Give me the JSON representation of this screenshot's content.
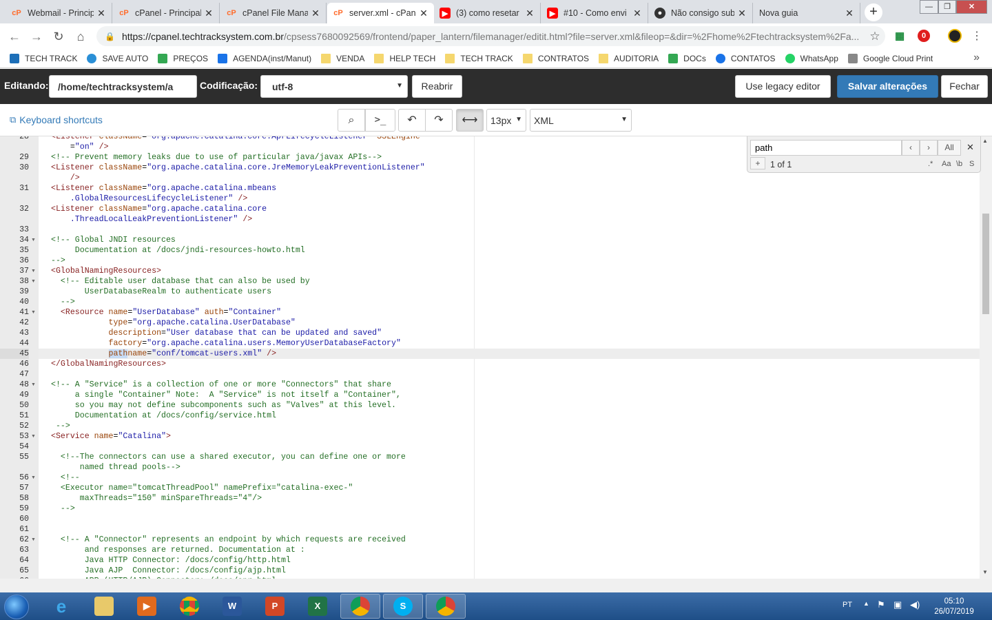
{
  "browser": {
    "tabs": [
      {
        "icon": "cpanel-icon",
        "title": "Webmail - Princip",
        "active": false
      },
      {
        "icon": "cpanel-icon",
        "title": "cPanel - Principal",
        "active": false
      },
      {
        "icon": "cpanel-icon",
        "title": "cPanel File Mana",
        "active": false
      },
      {
        "icon": "cpanel-icon",
        "title": "server.xml - cPan",
        "active": true
      },
      {
        "icon": "youtube-icon",
        "title": "(3) como resetar",
        "active": false
      },
      {
        "icon": "youtube-icon",
        "title": "#10 - Como envi",
        "active": false
      },
      {
        "icon": "github-icon",
        "title": "Não consigo sub",
        "active": false
      },
      {
        "icon": "",
        "title": "Nova guia",
        "active": false
      }
    ],
    "url_host": "https://cpanel.techtracksystem.com.br",
    "url_path": "/cpsess7680092569/frontend/paper_lantern/filemanager/editit.html?file=server.xml&fileop=&dir=%2Fhome%2Ftechtracksystem%2Fa...",
    "bookmarks": [
      {
        "label": "TECH TRACK",
        "icon": "techtrack-icon"
      },
      {
        "label": "SAVE AUTO",
        "icon": "saveauto-icon"
      },
      {
        "label": "PREÇOS",
        "icon": "drive-icon"
      },
      {
        "label": "AGENDA(inst/Manut)",
        "icon": "calendar-icon"
      },
      {
        "label": "VENDA",
        "icon": "folder-icon"
      },
      {
        "label": "HELP TECH",
        "icon": "folder-icon"
      },
      {
        "label": "TECH TRACK",
        "icon": "folder-icon"
      },
      {
        "label": "CONTRATOS",
        "icon": "folder-icon"
      },
      {
        "label": "AUDITORIA",
        "icon": "folder-icon"
      },
      {
        "label": "DOCs",
        "icon": "drive-icon"
      },
      {
        "label": "CONTATOS",
        "icon": "contacts-icon"
      },
      {
        "label": "WhatsApp",
        "icon": "whatsapp-icon"
      },
      {
        "label": "Google Cloud Print",
        "icon": "print-icon"
      }
    ],
    "bookmarks_more": "»"
  },
  "editor_header": {
    "editing_label": "Editando:",
    "path_value": "/home/techtracksystem/a",
    "encoding_label": "Codificação:",
    "encoding_value": "utf-8",
    "reopen": "Reabrir",
    "legacy": "Use legacy editor",
    "save": "Salvar alterações",
    "close": "Fechar"
  },
  "toolbar": {
    "shortcuts": "Keyboard shortcuts",
    "font_size": "13px",
    "mode": "XML"
  },
  "search": {
    "query": "path",
    "all": "All",
    "plus": "+",
    "count": "1 of 1",
    "regex": ".*",
    "case": "Aa",
    "word": "\\b",
    "sel": "S"
  },
  "code_lines": [
    {
      "n": "28",
      "f": false,
      "h": "<span class=\"t\">&lt;Listener</span> <span class=\"a\">className</span>=<span class=\"s\">\"org.apache.catalina.core.AprLifecycleListener\"</span> <span class=\"a\">SSLEngine</span>"
    },
    {
      "n": "",
      "f": false,
      "h": "    =<span class=\"s\">\"on\"</span> <span class=\"t\">/&gt;</span>"
    },
    {
      "n": "29",
      "f": false,
      "h": "<span class=\"c\">&lt;!-- Prevent memory leaks due to use of particular java/javax APIs--&gt;</span>"
    },
    {
      "n": "30",
      "f": false,
      "h": "<span class=\"t\">&lt;Listener</span> <span class=\"a\">className</span>=<span class=\"s\">\"org.apache.catalina.core.JreMemoryLeakPreventionListener\"</span>"
    },
    {
      "n": "",
      "f": false,
      "h": "    <span class=\"t\">/&gt;</span>"
    },
    {
      "n": "31",
      "f": false,
      "h": "<span class=\"t\">&lt;Listener</span> <span class=\"a\">className</span>=<span class=\"s\">\"org.apache.catalina.mbeans</span>"
    },
    {
      "n": "",
      "f": false,
      "h": "    <span class=\"s\">.GlobalResourcesLifecycleListener\"</span> <span class=\"t\">/&gt;</span>"
    },
    {
      "n": "32",
      "f": false,
      "h": "<span class=\"t\">&lt;Listener</span> <span class=\"a\">className</span>=<span class=\"s\">\"org.apache.catalina.core</span>"
    },
    {
      "n": "",
      "f": false,
      "h": "    <span class=\"s\">.ThreadLocalLeakPreventionListener\"</span> <span class=\"t\">/&gt;</span>"
    },
    {
      "n": "33",
      "f": false,
      "h": ""
    },
    {
      "n": "34",
      "f": true,
      "h": "<span class=\"c\">&lt;!-- Global JNDI resources</span>"
    },
    {
      "n": "35",
      "f": false,
      "h": "<span class=\"c\">     Documentation at /docs/jndi-resources-howto.html</span>"
    },
    {
      "n": "36",
      "f": false,
      "h": "<span class=\"c\">--&gt;</span>"
    },
    {
      "n": "37",
      "f": true,
      "h": "<span class=\"t\">&lt;GlobalNamingResources&gt;</span>"
    },
    {
      "n": "38",
      "f": true,
      "h": "  <span class=\"c\">&lt;!-- Editable user database that can also be used by</span>"
    },
    {
      "n": "39",
      "f": false,
      "h": "<span class=\"c\">       UserDatabaseRealm to authenticate users</span>"
    },
    {
      "n": "40",
      "f": false,
      "h": "<span class=\"c\">  --&gt;</span>"
    },
    {
      "n": "41",
      "f": true,
      "h": "  <span class=\"t\">&lt;Resource</span> <span class=\"a\">name</span>=<span class=\"s\">\"UserDatabase\"</span> <span class=\"a\">auth</span>=<span class=\"s\">\"Container\"</span>"
    },
    {
      "n": "42",
      "f": false,
      "h": "            <span class=\"a\">type</span>=<span class=\"s\">\"org.apache.catalina.UserDatabase\"</span>"
    },
    {
      "n": "43",
      "f": false,
      "h": "            <span class=\"a\">description</span>=<span class=\"s\">\"User database that can be updated and saved\"</span>"
    },
    {
      "n": "44",
      "f": false,
      "h": "            <span class=\"a\">factory</span>=<span class=\"s\">\"org.apache.catalina.users.MemoryUserDatabaseFactory\"</span>"
    },
    {
      "n": "45",
      "f": false,
      "h": "            <span class=\"a\"><span class=\"hl\">path</span>name</span>=<span class=\"s\">\"conf/tomcat-users.xml\"</span> <span class=\"t\">/&gt;</span>"
    },
    {
      "n": "46",
      "f": false,
      "h": "<span class=\"t\">&lt;/GlobalNamingResources&gt;</span>"
    },
    {
      "n": "47",
      "f": false,
      "h": ""
    },
    {
      "n": "48",
      "f": true,
      "h": "<span class=\"c\">&lt;!-- A \"Service\" is a collection of one or more \"Connectors\" that share</span>"
    },
    {
      "n": "49",
      "f": false,
      "h": "<span class=\"c\">     a single \"Container\" Note:  A \"Service\" is not itself a \"Container\",</span>"
    },
    {
      "n": "50",
      "f": false,
      "h": "<span class=\"c\">     so you may not define subcomponents such as \"Valves\" at this level.</span>"
    },
    {
      "n": "51",
      "f": false,
      "h": "<span class=\"c\">     Documentation at /docs/config/service.html</span>"
    },
    {
      "n": "52",
      "f": false,
      "h": "<span class=\"c\"> --&gt;</span>"
    },
    {
      "n": "53",
      "f": true,
      "h": "<span class=\"t\">&lt;Service</span> <span class=\"a\">name</span>=<span class=\"s\">\"Catalina\"</span><span class=\"t\">&gt;</span>"
    },
    {
      "n": "54",
      "f": false,
      "h": ""
    },
    {
      "n": "55",
      "f": false,
      "h": "  <span class=\"c\">&lt;!--The connectors can use a shared executor, you can define one or more</span>"
    },
    {
      "n": "",
      "f": false,
      "h": "<span class=\"c\">      named thread pools--&gt;</span>"
    },
    {
      "n": "56",
      "f": true,
      "h": "  <span class=\"c\">&lt;!--</span>"
    },
    {
      "n": "57",
      "f": false,
      "h": "<span class=\"c\">  &lt;Executor name=\"tomcatThreadPool\" namePrefix=\"catalina-exec-\"</span>"
    },
    {
      "n": "58",
      "f": false,
      "h": "<span class=\"c\">      maxThreads=\"150\" minSpareThreads=\"4\"/&gt;</span>"
    },
    {
      "n": "59",
      "f": false,
      "h": "<span class=\"c\">  --&gt;</span>"
    },
    {
      "n": "60",
      "f": false,
      "h": ""
    },
    {
      "n": "61",
      "f": false,
      "h": ""
    },
    {
      "n": "62",
      "f": true,
      "h": "  <span class=\"c\">&lt;!-- A \"Connector\" represents an endpoint by which requests are received</span>"
    },
    {
      "n": "63",
      "f": false,
      "h": "<span class=\"c\">       and responses are returned. Documentation at :</span>"
    },
    {
      "n": "64",
      "f": false,
      "h": "<span class=\"c\">       Java HTTP Connector: /docs/config/http.html</span>"
    },
    {
      "n": "65",
      "f": false,
      "h": "<span class=\"c\">       Java AJP  Connector: /docs/config/ajp.html</span>"
    },
    {
      "n": "66",
      "f": false,
      "h": "<span class=\"c\">       APR (HTTP/AJP) Connector: /docs/apr.html</span>"
    }
  ],
  "active_line": "45",
  "taskbar": {
    "lang": "PT",
    "time": "05:10",
    "date": "26/07/2019"
  }
}
